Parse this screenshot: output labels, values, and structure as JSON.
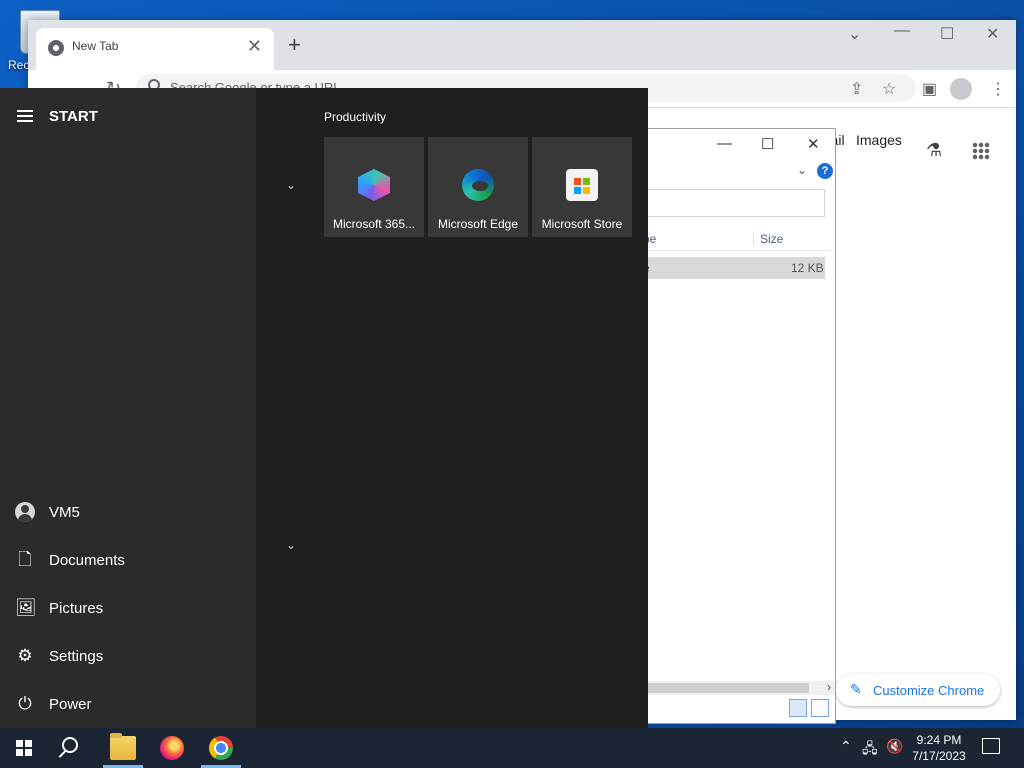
{
  "desktop": {
    "recycle_bin_label": "Rec"
  },
  "chrome": {
    "tab_title": "New Tab",
    "tab_close": "✕",
    "new_tab": "+",
    "omnibox_placeholder": "Search Google or type a URL",
    "header_links": {
      "gmail": "Gmail",
      "images": "Images"
    },
    "customize_label": "Customize Chrome"
  },
  "explorer": {
    "columns": {
      "type": "pe",
      "size": "Size"
    },
    "row": {
      "type": "e",
      "size": "12 KB"
    }
  },
  "start_menu": {
    "title": "START",
    "group_title": "Productivity",
    "tiles": [
      {
        "label": "Microsoft 365...",
        "icon": "microsoft-365-icon"
      },
      {
        "label": "Microsoft Edge",
        "icon": "edge-icon"
      },
      {
        "label": "Microsoft Store",
        "icon": "store-icon"
      }
    ],
    "rail": {
      "user": "VM5",
      "documents": "Documents",
      "pictures": "Pictures",
      "settings": "Settings",
      "power": "Power"
    }
  },
  "taskbar": {
    "time": "9:24 PM",
    "date": "7/17/2023",
    "apps": [
      "file-explorer-icon",
      "firefox-icon",
      "chrome-icon"
    ]
  },
  "colors": {
    "start_bg": "#1f1f1f",
    "rail_bg": "#2b2b2b",
    "tile_bg": "#383838",
    "taskbar_bg": "#1b2533",
    "chrome_accent": "#1a73e8"
  }
}
